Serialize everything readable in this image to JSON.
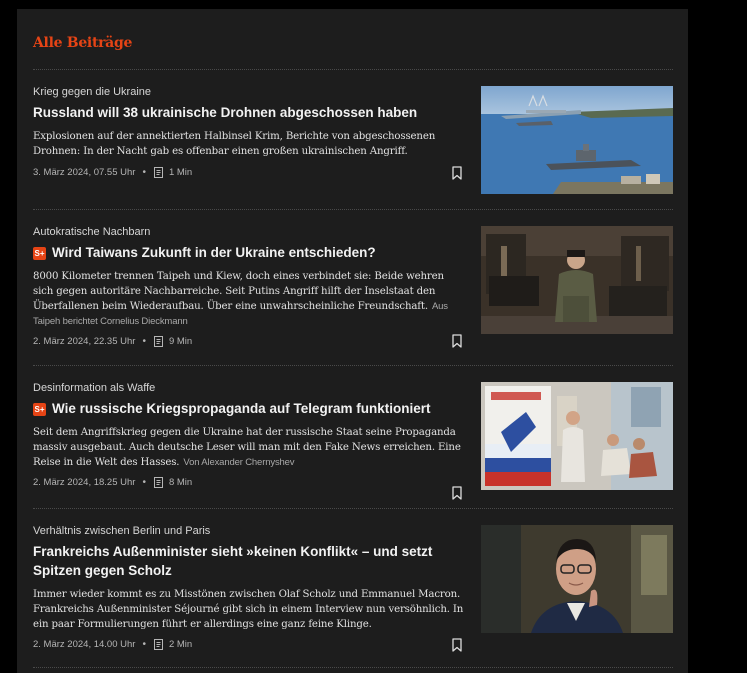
{
  "section": {
    "title": "Alle Beiträge"
  },
  "articles": [
    {
      "kicker": "Krieg gegen die Ukraine",
      "plus": false,
      "headline": "Russland will 38 ukrainische Drohnen abgeschossen haben",
      "teaser": "Explosionen auf der annektierten Halbinsel Krim, Berichte von abgeschossenen Drohnen: In der Nacht gab es offenbar einen großen ukrainischen Angriff.",
      "author": "",
      "date": "3. März 2024, 07.55 Uhr",
      "read_time": "1 Min"
    },
    {
      "kicker": "Autokratische Nachbarn",
      "plus": true,
      "headline": "Wird Taiwans Zukunft in der Ukraine entschieden?",
      "teaser": "8000 Kilometer trennen Taipeh und Kiew, doch eines verbindet sie: Beide wehren sich gegen autoritäre Nachbarreiche. Seit Putins Angriff hilft der Inselstaat den Überfallenen beim Wiederaufbau. Über eine unwahrscheinliche Freundschaft.",
      "author": "Aus Taipeh berichtet Cornelius Dieckmann",
      "date": "2. März 2024, 22.35 Uhr",
      "read_time": "9 Min"
    },
    {
      "kicker": "Desinformation als Waffe",
      "plus": true,
      "headline": "Wie russische Kriegspropaganda auf Telegram funktioniert",
      "teaser": "Seit dem Angriffskrieg gegen die Ukraine hat der russische Staat seine Propaganda massiv ausgebaut. Auch deutsche Leser will man mit den Fake News erreichen. Eine Reise in die Welt des Hasses.",
      "author": "Von Alexander Chernyshev",
      "date": "2. März 2024, 18.25 Uhr",
      "read_time": "8 Min"
    },
    {
      "kicker": "Verhältnis zwischen Berlin und Paris",
      "plus": false,
      "headline": "Frankreichs Außenminister sieht »keinen Konflikt« – und setzt Spitzen gegen Scholz",
      "teaser": "Immer wieder kommt es zu Misstönen zwischen Olaf Scholz und Emmanuel Macron. Frankreichs Außenminister Séjourné gibt sich in einem Interview nun versöhnlich. In ein paar Formulierungen führt er allerdings eine ganz feine Klinge.",
      "author": "",
      "date": "2. März 2024, 14.00 Uhr",
      "read_time": "2 Min"
    }
  ],
  "plus_badge": {
    "label": "S+"
  },
  "icons": {
    "meta_separator": "•",
    "read_time_icon": "document-icon",
    "bookmark_icon": "bookmark-icon"
  },
  "colors": {
    "accent": "#e64415",
    "panel_bg": "#1d1d1d",
    "page_bg": "#000000",
    "headline": "#f2f2f2",
    "meta": "#b5b5b5"
  }
}
